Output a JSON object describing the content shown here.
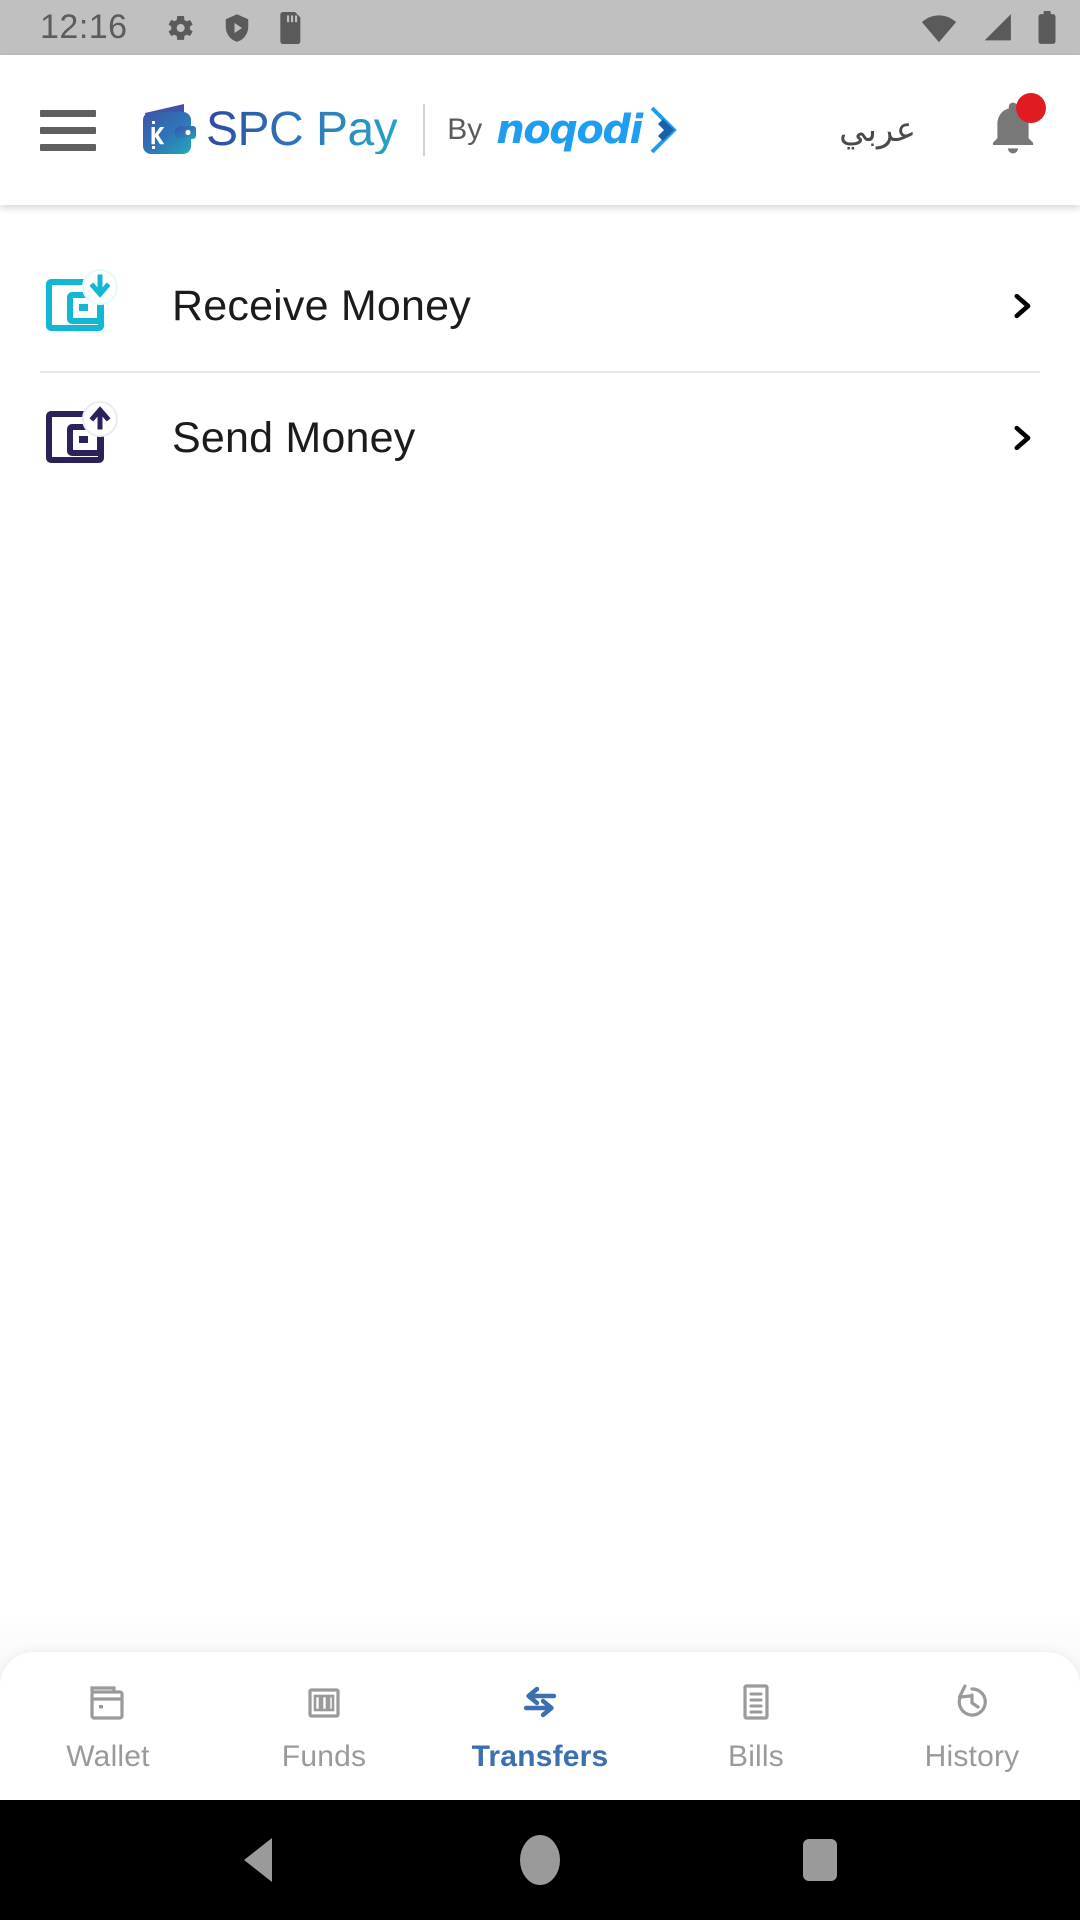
{
  "status_bar": {
    "time": "12:16",
    "left_icons": [
      "gear-icon",
      "play-protect-icon",
      "sd-card-icon"
    ],
    "right_icons": [
      "wifi-icon",
      "cellular-signal-icon",
      "battery-icon"
    ],
    "background_color": "#c0c0c0",
    "foreground_color": "#5a5a5a"
  },
  "header": {
    "menu_icon": "hamburger-menu-icon",
    "brand": {
      "wallet_icon": "spc-wallet-logo-icon",
      "title": "SPC Pay",
      "by_label": "By",
      "partner": "noqodi",
      "partner_color": "#1e9ef0",
      "title_gradient_from": "#2e4a9e",
      "title_gradient_to": "#25a6c4"
    },
    "language_toggle": "عربي",
    "notification": {
      "icon": "bell-icon",
      "has_unread": true,
      "badge_color": "#e11b22"
    }
  },
  "main": {
    "menu_items": [
      {
        "label": "Receive Money",
        "icon": "receive-money-icon",
        "icon_color": "#10b8d4",
        "chevron": "chevron-right-icon"
      },
      {
        "label": "Send Money",
        "icon": "send-money-icon",
        "icon_color": "#2c2259",
        "chevron": "chevron-right-icon"
      }
    ]
  },
  "bottom_nav": {
    "active_color": "#3a6fb0",
    "inactive_color": "#9a9a9a",
    "items": [
      {
        "label": "Wallet",
        "icon": "wallet-icon",
        "active": false
      },
      {
        "label": "Funds",
        "icon": "funds-icon",
        "active": false
      },
      {
        "label": "Transfers",
        "icon": "transfers-icon",
        "active": true
      },
      {
        "label": "Bills",
        "icon": "bills-icon",
        "active": false
      },
      {
        "label": "History",
        "icon": "history-icon",
        "active": false
      }
    ]
  },
  "system_nav": {
    "back": "back-triangle-icon",
    "home": "home-circle-icon",
    "recents": "recents-square-icon"
  }
}
